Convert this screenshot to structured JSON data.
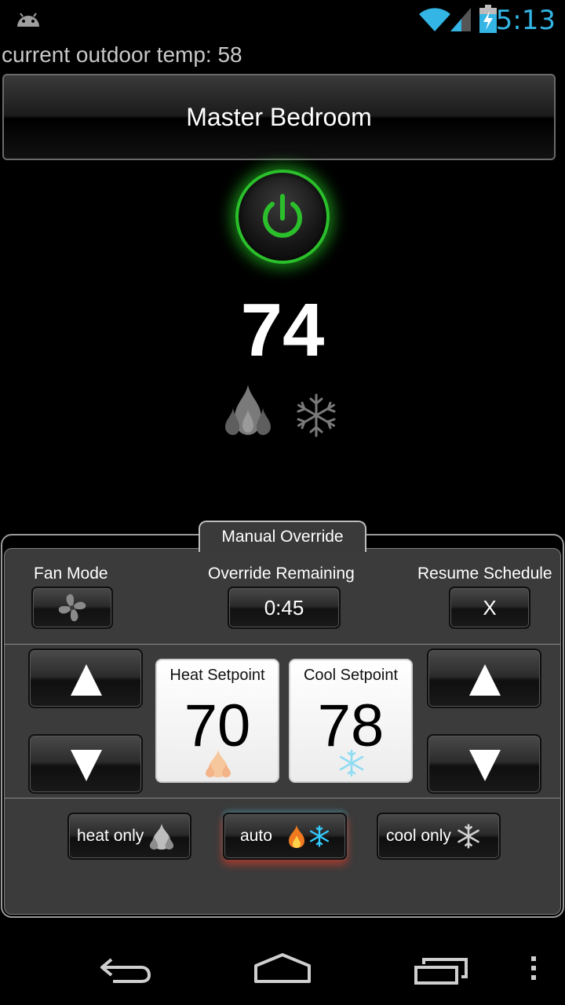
{
  "status_bar": {
    "time": "5:13",
    "icons": [
      "android-icon",
      "wifi-icon",
      "signal-icon",
      "battery-charging-icon"
    ],
    "accent_color": "#33b5e5"
  },
  "outdoor": {
    "label": "current outdoor temp: 58"
  },
  "room": {
    "name": "Master Bedroom"
  },
  "power": {
    "icon": "power-icon",
    "state_color": "#2bbf2b"
  },
  "current_temp": "74",
  "status_icons": [
    "flame-icon",
    "snowflake-icon"
  ],
  "override": {
    "tab_label": "Manual Override",
    "fan_mode_label": "Fan Mode",
    "fan_icon": "fan-icon",
    "override_remaining_label": "Override Remaining",
    "override_remaining_value": "0:45",
    "resume_schedule_label": "Resume Schedule",
    "resume_schedule_button": "X",
    "heat_setpoint": {
      "title": "Heat Setpoint",
      "value": "70",
      "icon": "flame-icon"
    },
    "cool_setpoint": {
      "title": "Cool Setpoint",
      "value": "78",
      "icon": "snowflake-icon"
    },
    "modes": [
      {
        "label": "heat only",
        "icon": "flame-icon",
        "active": false
      },
      {
        "label": "auto",
        "icon": "flame-and-snowflake-icon",
        "active": true
      },
      {
        "label": "cool only",
        "icon": "snowflake-icon",
        "active": false
      }
    ]
  },
  "nav_bar": {
    "icons": [
      "back-icon",
      "home-icon",
      "recents-icon",
      "menu-icon"
    ]
  }
}
